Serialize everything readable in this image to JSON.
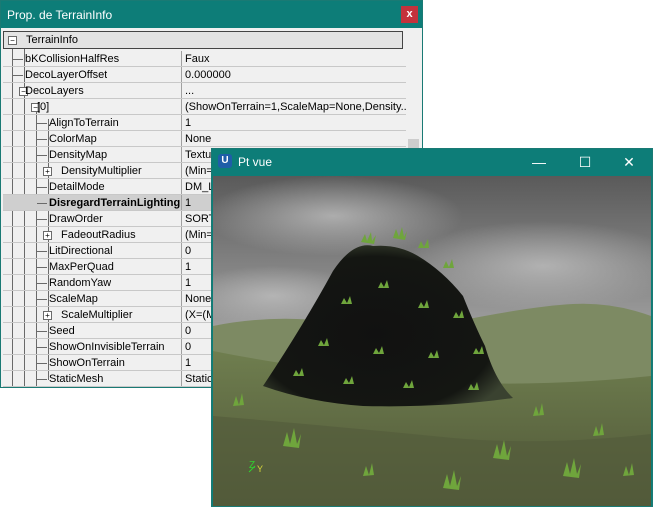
{
  "prop_window": {
    "title": "Prop. de TerrainInfo",
    "close_glyph": "x",
    "header_label": "TerrainInfo",
    "rows": [
      {
        "label": "bKCollisionHalfRes",
        "value": "Faux"
      },
      {
        "label": "DecoLayerOffset",
        "value": "0.000000"
      },
      {
        "label": "DecoLayers",
        "value": "..."
      },
      {
        "label": "[0]",
        "value": "(ShowOnTerrain=1,ScaleMap=None,Density..."
      },
      {
        "label": "AlignToTerrain",
        "value": "1"
      },
      {
        "label": "ColorMap",
        "value": "None"
      },
      {
        "label": "DensityMap",
        "value": "Textu"
      },
      {
        "label": "DensityMultiplier",
        "value": "(Min="
      },
      {
        "label": "DetailMode",
        "value": "DM_L"
      },
      {
        "label": "DisregardTerrainLighting",
        "value": "1"
      },
      {
        "label": "DrawOrder",
        "value": "SORT"
      },
      {
        "label": "FadeoutRadius",
        "value": "(Min="
      },
      {
        "label": "LitDirectional",
        "value": "0"
      },
      {
        "label": "MaxPerQuad",
        "value": "1"
      },
      {
        "label": "RandomYaw",
        "value": "1"
      },
      {
        "label": "ScaleMap",
        "value": "None"
      },
      {
        "label": "ScaleMultiplier",
        "value": "(X=(M"
      },
      {
        "label": "Seed",
        "value": "0"
      },
      {
        "label": "ShowOnInvisibleTerrain",
        "value": "0"
      },
      {
        "label": "ShowOnTerrain",
        "value": "1"
      },
      {
        "label": "StaticMesh",
        "value": "Static"
      }
    ]
  },
  "view_window": {
    "title": "Pt vue",
    "logo_glyph": "U",
    "minimize_glyph": "—",
    "maximize_glyph": "☐",
    "close_glyph": "✕",
    "axis_z": "Z",
    "axis_y": "Y"
  },
  "colors": {
    "titlebar": "#0d7d78",
    "close_button": "#c4323c"
  },
  "icons": [
    "close-icon",
    "unreal-logo-icon",
    "minimize-icon",
    "maximize-icon",
    "expand-collapse-icon"
  ]
}
